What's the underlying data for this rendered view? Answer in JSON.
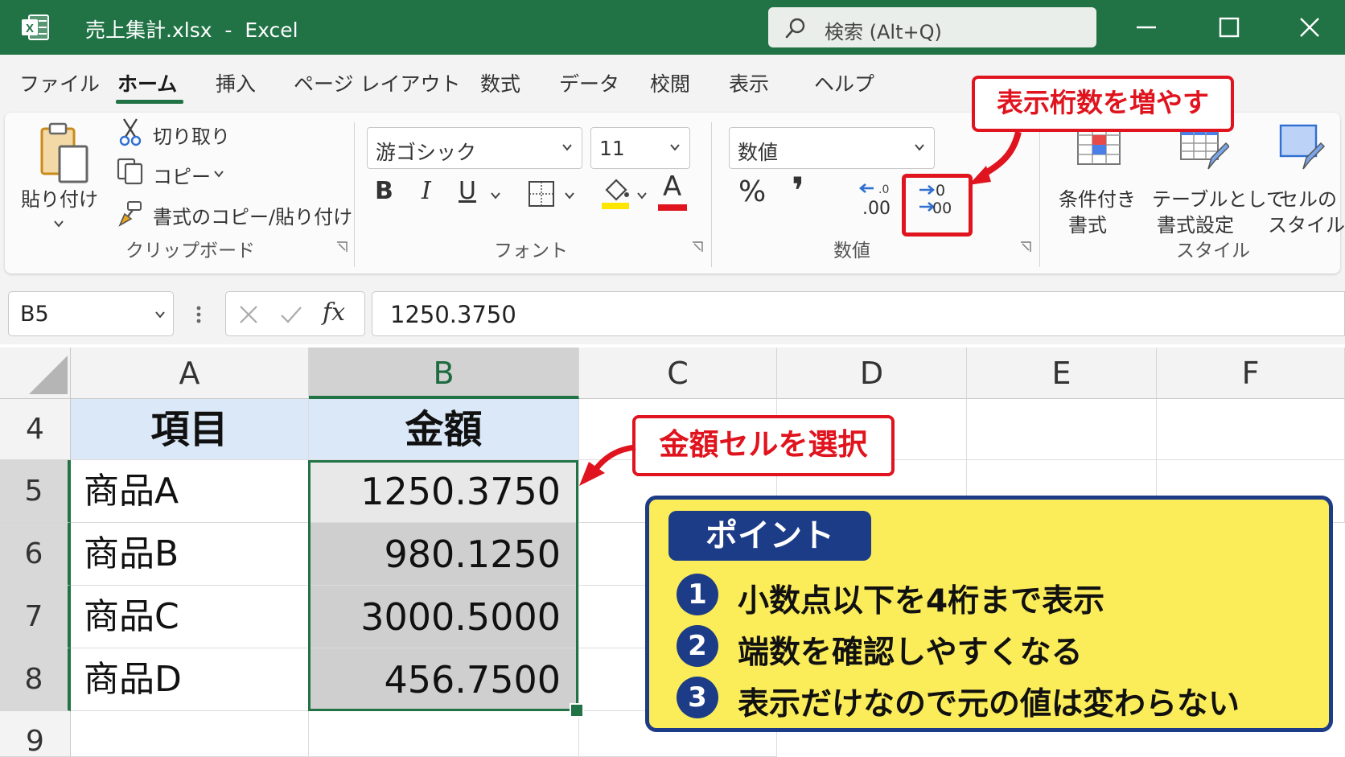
{
  "window": {
    "title": "売上集計.xlsx  -  Excel",
    "search_placeholder": "検索 (Alt+Q)",
    "accent_color": "#217346"
  },
  "menu": {
    "tabs": [
      "ファイル",
      "ホーム",
      "挿入",
      "ページ レイアウト",
      "数式",
      "データ",
      "校閲",
      "表示",
      "ヘルプ"
    ],
    "active": "ホーム"
  },
  "ribbon": {
    "clipboard": {
      "paste": "貼り付け",
      "cut": "切り取り",
      "copy": "コピー",
      "format_painter": "書式のコピー/貼り付け",
      "label": "クリップボード"
    },
    "font": {
      "family": "游ゴシック",
      "size": "11",
      "bold": "B",
      "italic": "I",
      "underline": "U",
      "font_color_letter": "A",
      "label": "フォント"
    },
    "number": {
      "format": "数値",
      "percent": "%",
      "comma": "❜",
      "label": "数値"
    },
    "styles": {
      "conditional_1": "条件付き",
      "conditional_2": "書式",
      "table_1": "テーブルとして",
      "table_2": "書式設定",
      "cell_1": "セルの",
      "cell_2": "スタイル",
      "label": "スタイル"
    }
  },
  "formula_bar": {
    "name_box": "B5",
    "fx": "fx",
    "value": "1250.3750"
  },
  "sheet": {
    "columns": [
      "A",
      "B",
      "C",
      "D",
      "E",
      "F"
    ],
    "rows": [
      "4",
      "5",
      "6",
      "7",
      "8",
      "9"
    ],
    "header": {
      "item": "項目",
      "amount": "金額"
    },
    "data": [
      {
        "item": "商品A",
        "amount": "1250.3750"
      },
      {
        "item": "商品B",
        "amount": "980.1250"
      },
      {
        "item": "商品C",
        "amount": "3000.5000"
      },
      {
        "item": "商品D",
        "amount": "456.7500"
      }
    ]
  },
  "annotations": {
    "increase_decimal": "表示桁数を増やす",
    "select_cells": "金額セルを選択",
    "point_title": "ポイント",
    "points": [
      {
        "num": "1",
        "text": "小数点以下を4桁まで表示"
      },
      {
        "num": "2",
        "text": "端数を確認しやすくなる"
      },
      {
        "num": "3",
        "text": "表示だけなので元の値は変わらない"
      }
    ],
    "highlight_color": "#e0141e",
    "point_bg": "#fbec5a",
    "point_border": "#1d3c87"
  }
}
